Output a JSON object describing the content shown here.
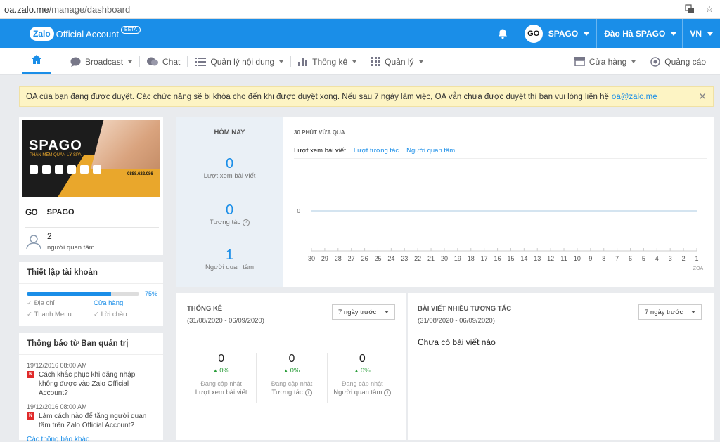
{
  "browser": {
    "url_host": "oa.zalo.me",
    "url_path": "/manage/dashboard"
  },
  "brand": {
    "logo": "Zalo",
    "name": "Official Account",
    "beta": "BETA"
  },
  "topbar": {
    "account_name": "SPAGO",
    "account_avatar": "GO",
    "user_name": "Đào Hà SPAGO",
    "lang": "VN"
  },
  "nav": {
    "items": [
      {
        "label": "Broadcast",
        "icon": "chat-bubble-icon"
      },
      {
        "label": "Chat",
        "icon": "messages-icon"
      },
      {
        "label": "Quản lý nội dung",
        "icon": "list-icon"
      },
      {
        "label": "Thống kê",
        "icon": "bar-chart-icon"
      },
      {
        "label": "Quản lý",
        "icon": "grid-icon"
      }
    ],
    "store": "Cửa hàng",
    "ads": "Quảng cáo"
  },
  "alert": {
    "text": "OA của bạn đang được duyệt. Các chức năng sẽ bị khóa cho đến khi được duyệt xong. Nếu sau 7 ngày làm việc, OA vẫn chưa được duyệt thì bạn vui lòng liên hệ",
    "email": "oa@zalo.me"
  },
  "profile": {
    "banner_title": "SPAGO",
    "banner_sub": "PHẦN MỀM QUẢN LÝ SPA",
    "banner_phone": "0888.622.086",
    "name": "SPAGO",
    "followers": "2",
    "followers_label": "người quan tâm"
  },
  "setup": {
    "title": "Thiết lập tài khoản",
    "progress": 75,
    "progress_label": "75%",
    "items": [
      "Địa chỉ",
      "Cửa hàng",
      "Thanh Menu",
      "Lời chào"
    ]
  },
  "notices": {
    "title": "Thông báo từ Ban quản trị",
    "items": [
      {
        "date": "19/12/2016 08:00 AM",
        "badge": "N",
        "text": "Cách khắc phục khi đăng nhập không được vào Zalo Official Account?"
      },
      {
        "date": "19/12/2016 08:00 AM",
        "badge": "N",
        "text": "Làm cách nào để tăng người quan tâm trên Zalo Official Account?"
      }
    ],
    "more": "Các thông báo khác"
  },
  "today": {
    "title": "HÔM NAY",
    "stats": [
      {
        "value": "0",
        "label": "Lượt xem bài viết"
      },
      {
        "value": "0",
        "label": "Tương tác"
      },
      {
        "value": "1",
        "label": "Người quan tâm"
      }
    ]
  },
  "last30": {
    "title": "30 PHÚT VỪA QUA",
    "tabs": [
      "Lượt xem bài viết",
      "Lượt tương tác",
      "Người quan tâm"
    ]
  },
  "chart_data": {
    "type": "line",
    "x": [
      30,
      29,
      28,
      27,
      26,
      25,
      24,
      23,
      22,
      21,
      20,
      19,
      18,
      17,
      16,
      15,
      14,
      13,
      12,
      11,
      10,
      9,
      8,
      7,
      6,
      5,
      4,
      3,
      2,
      1
    ],
    "series": [
      {
        "values": [
          0,
          0,
          0,
          0,
          0,
          0,
          0,
          0,
          0,
          0,
          0,
          0,
          0,
          0,
          0,
          0,
          0,
          0,
          0,
          0,
          0,
          0,
          0,
          0,
          0,
          0,
          0,
          0,
          0,
          0
        ]
      }
    ],
    "yticks": [
      "0"
    ],
    "xlabel": "ZOA",
    "ylim": [
      0,
      1
    ]
  },
  "stats7": {
    "title": "THỐNG KÊ",
    "range": "(31/08/2020 - 06/09/2020)",
    "select": "7 ngày trước",
    "metrics": [
      {
        "value": "0",
        "delta": "0%",
        "status": "Đang cập nhật",
        "label": "Lượt xem bài viết"
      },
      {
        "value": "0",
        "delta": "0%",
        "status": "Đang cập nhật",
        "label": "Tương tác"
      },
      {
        "value": "0",
        "delta": "0%",
        "status": "Đang cập nhật",
        "label": "Người quan tâm"
      }
    ]
  },
  "topposts": {
    "title": "BÀI VIẾT NHIỀU TƯƠNG TÁC",
    "range": "(31/08/2020 - 06/09/2020)",
    "select": "7 ngày trước",
    "empty": "Chưa có bài viết nào"
  }
}
